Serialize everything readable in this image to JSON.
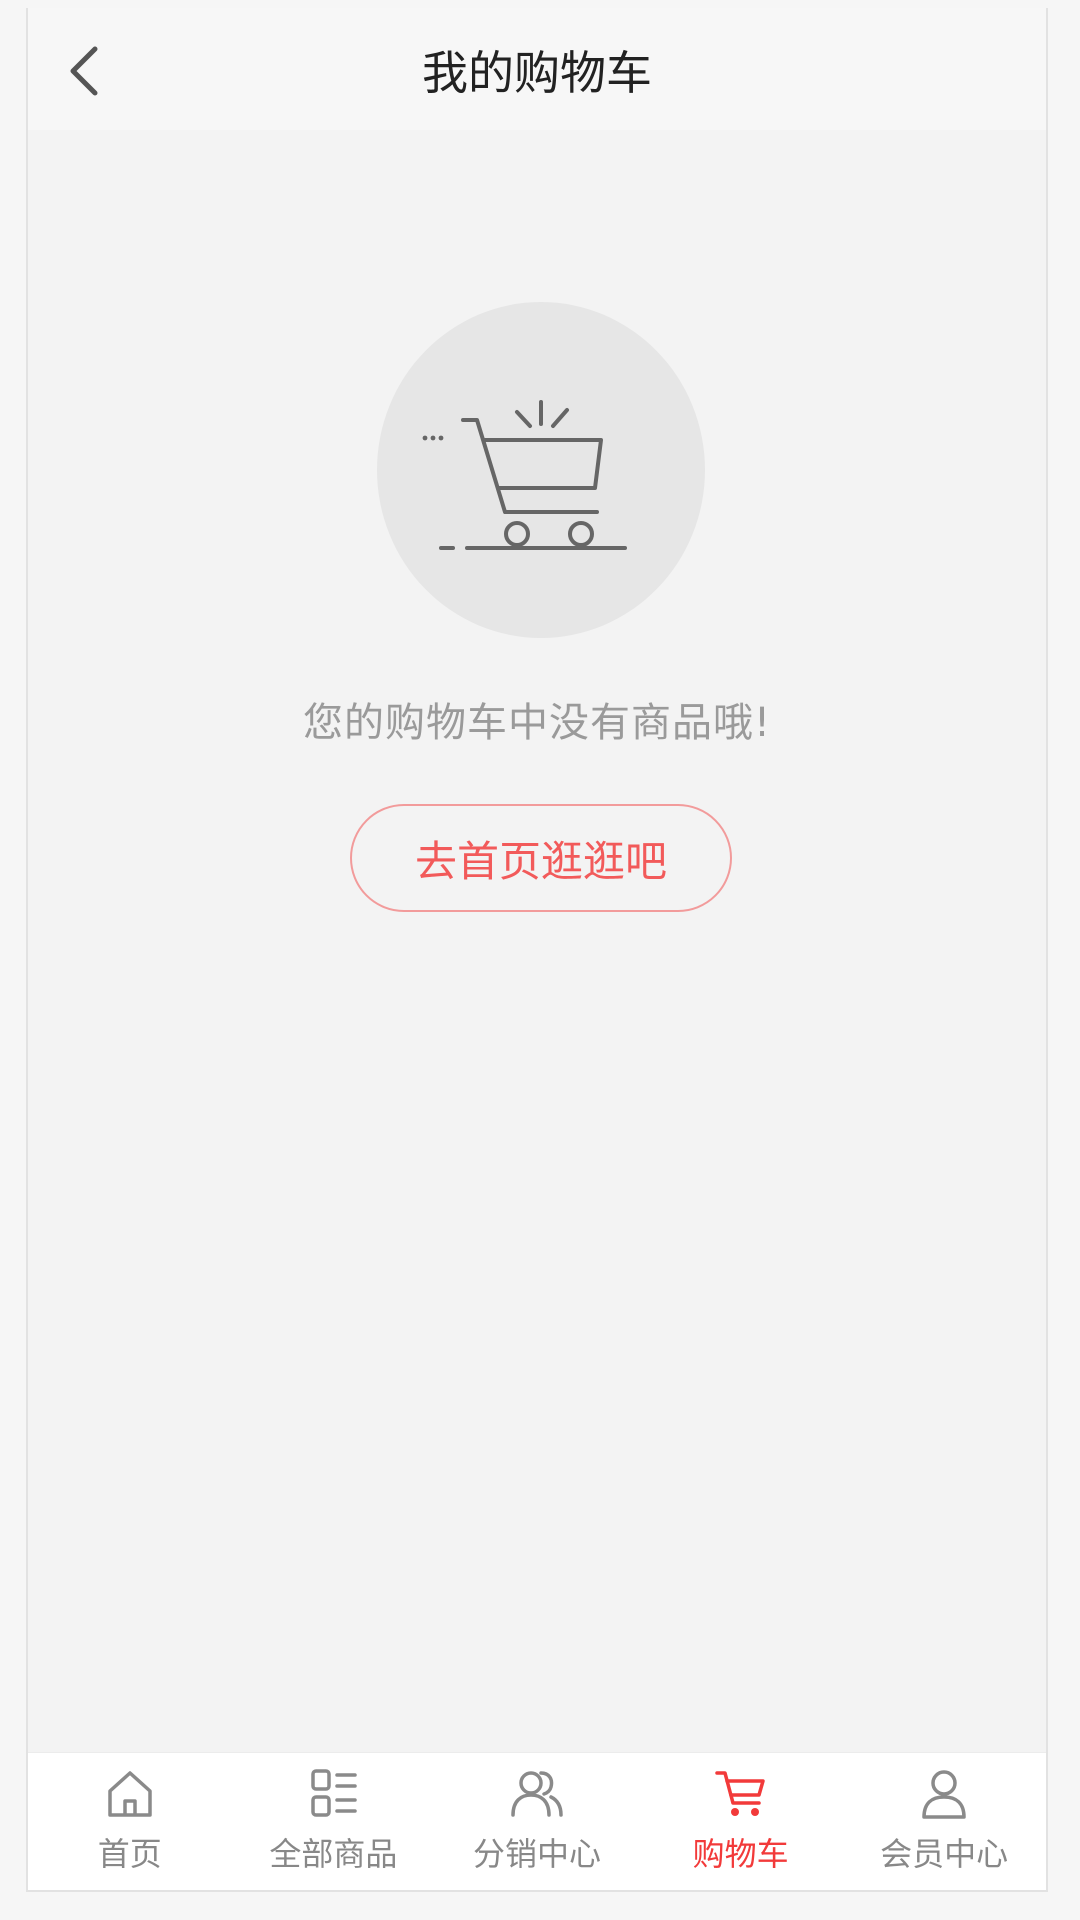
{
  "header": {
    "title": "我的购物车",
    "back_icon": "chevron-left-icon"
  },
  "empty_state": {
    "illustration_icon": "empty-cart-icon",
    "message": "您的购物车中没有商品哦!",
    "action_label": "去首页逛逛吧"
  },
  "tabbar": {
    "active_index": 3,
    "items": [
      {
        "label": "首页",
        "icon": "home-icon"
      },
      {
        "label": "全部商品",
        "icon": "category-list-icon"
      },
      {
        "label": "分销中心",
        "icon": "users-icon"
      },
      {
        "label": "购物车",
        "icon": "cart-icon"
      },
      {
        "label": "会员中心",
        "icon": "user-icon"
      }
    ]
  },
  "colors": {
    "accent": "#f23a3a",
    "button_border": "#f29b9b",
    "button_text": "#f25a5a",
    "background": "#f3f3f3",
    "icon_gray": "#8a8a8a"
  }
}
